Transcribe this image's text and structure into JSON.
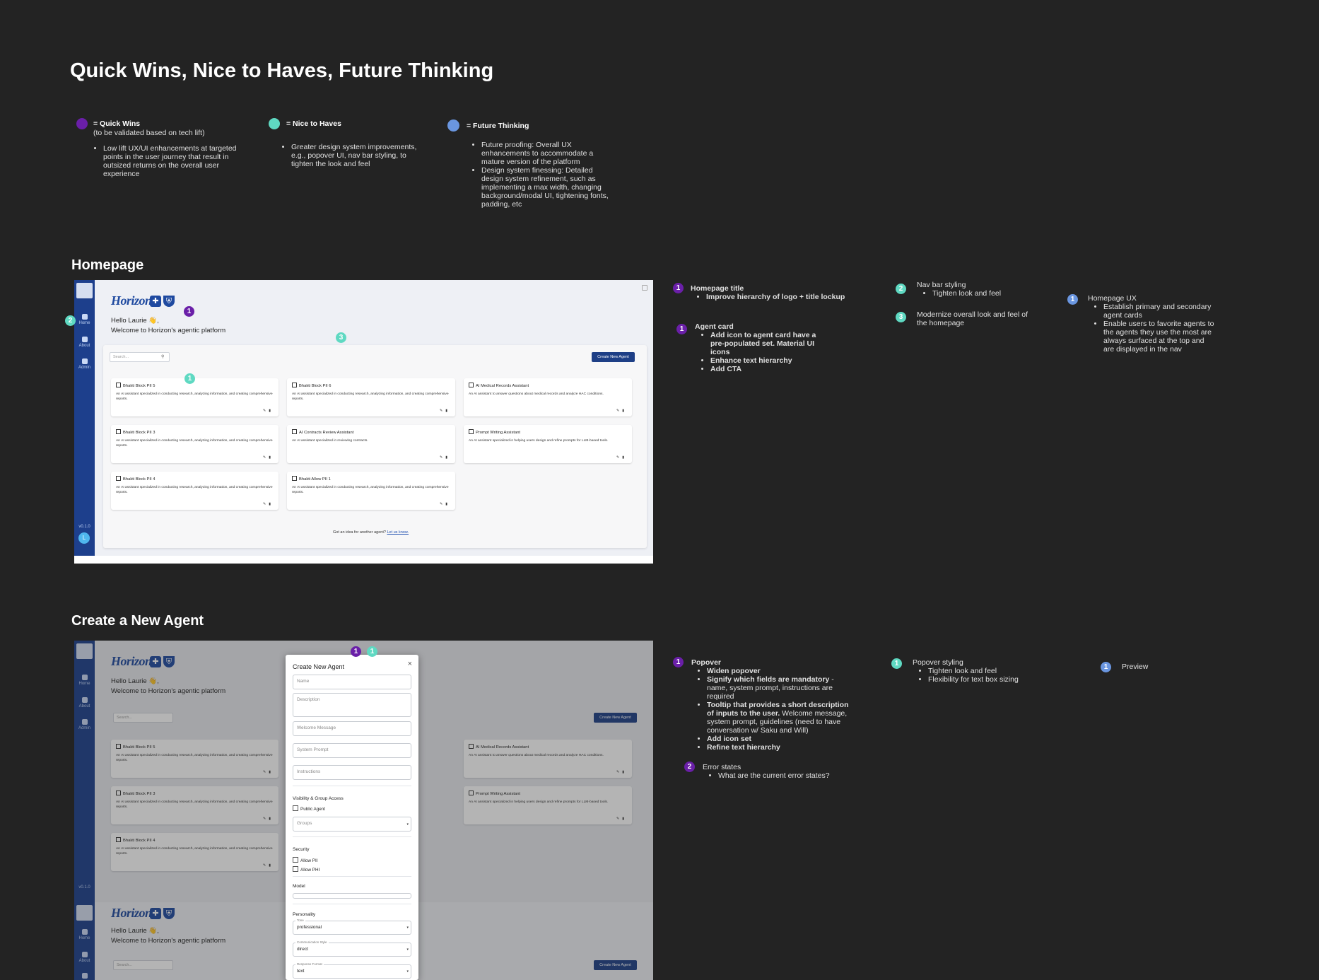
{
  "page_title": "Quick Wins, Nice to Haves, Future Thinking",
  "legend": {
    "quick_wins": {
      "title": "= Quick Wins",
      "subtitle": "(to be validated based on tech lift)",
      "bullets": [
        "Low lift UX/UI enhancements at targeted points in the user journey that result in outsized returns on the overall user experience"
      ]
    },
    "nice_to_haves": {
      "title": "= Nice to Haves",
      "bullets": [
        "Greater design system improvements, e.g., popover UI, nav bar styling, to tighten the look and feel"
      ]
    },
    "future_thinking": {
      "title": "= Future Thinking",
      "bullets": [
        "Future proofing: Overall UX enhancements to accommodate a mature version of the platform",
        "Design system finessing: Detailed design system refinement, such as implementing a max width, changing background/modal UI, tightening fonts, padding, etc"
      ]
    }
  },
  "colors": {
    "quick_wins": "#6a1fa8",
    "nice_to_haves": "#5fd9c2",
    "future_thinking": "#6a96e0"
  },
  "homepage": {
    "section_title": "Homepage",
    "markers": {
      "m1": "1",
      "m2": "2",
      "m3": "3",
      "m4": "1"
    },
    "ui": {
      "nav": {
        "home": "Home",
        "about": "About",
        "admin": "Admin",
        "version": "v0.1.0",
        "avatar": "L"
      },
      "logo_text": "Horizon.",
      "greeting": "Hello Laurie 👋,",
      "welcome": "Welcome to Horizon's agentic platform",
      "search_placeholder": "Search...",
      "create_button": "Create New Agent",
      "cards": [
        {
          "title": "Bhakti Block PII 5",
          "desc": "An AI assistant specialized in conducting research, analyzing information, and creating comprehensive reports."
        },
        {
          "title": "Bhakti Block PII 6",
          "desc": "An AI assistant specialized in conducting research, analyzing information, and creating comprehensive reports."
        },
        {
          "title": "AI Medical Records Assistant",
          "desc": "An AI assistant to answer questions about medical records and analyze HAC conditions."
        },
        {
          "title": "Bhakti Block PII 3",
          "desc": "An AI assistant specialized in conducting research, analyzing information, and creating comprehensive reports."
        },
        {
          "title": "AI Contracts Review Assistant",
          "desc": "An AI assistant specialized in reviewing contracts."
        },
        {
          "title": "Prompt Writing Assistant",
          "desc": "An AI assistant specialized in helping users design and refine prompts for LLM-based tools."
        },
        {
          "title": "Bhakti Block PII 4",
          "desc": "An AI assistant specialized in conducting research, analyzing information, and creating comprehensive reports."
        },
        {
          "title": "Bhakti Allow PII 1",
          "desc": "An AI assistant specialized in conducting research, analyzing information, and creating comprehensive reports."
        }
      ],
      "footer_text": "Got an idea for another agent?",
      "footer_link": "Let us know."
    },
    "notes": {
      "title_note": {
        "num": "1",
        "title": "Homepage title",
        "bullets": [
          "Improve hierarchy of logo + title lockup"
        ]
      },
      "card_note": {
        "num": "1",
        "title": "Agent card",
        "bullets": [
          "Add icon to agent card have a pre-populated set. Material UI icons",
          "Enhance text hierarchy",
          "Add CTA"
        ]
      },
      "nav_note": {
        "num": "2",
        "title": "Nav bar styling",
        "bullets": [
          "Tighten look and feel"
        ]
      },
      "modern_note": {
        "num": "3",
        "text": "Modernize overall look and feel of the homepage"
      },
      "ux_note": {
        "num": "1",
        "title": "Homepage UX",
        "bullets": [
          "Establish primary and secondary agent cards",
          "Enable users to favorite agents to the agents they use the most are always surfaced at the top and are displayed in the nav"
        ]
      }
    }
  },
  "create_agent": {
    "section_title": "Create a New Agent",
    "markers": {
      "m1": "1",
      "m2": "1"
    },
    "modal": {
      "title": "Create New Agent",
      "close": "×",
      "fields": {
        "name": "Name",
        "description": "Description",
        "welcome": "Welcome Message",
        "system_prompt": "System Prompt",
        "instructions": "Instructions"
      },
      "visibility_label": "Visibility & Group Access",
      "public_agent": "Public Agent",
      "groups": "Groups",
      "security_label": "Security",
      "allow_pii": "Allow PII",
      "allow_phi": "Allow PHI",
      "model_label": "Model",
      "personality_label": "Personality",
      "tone_label": "Tone",
      "tone_value": "professional",
      "comm_label": "Communication Style",
      "comm_value": "direct",
      "format_label": "Response Format",
      "format_value": "text"
    },
    "notes": {
      "popover": {
        "num": "1",
        "title": "Popover",
        "items": [
          {
            "bold": "Widen popover",
            "rest": ""
          },
          {
            "bold": "Signify which fields are mandatory",
            "rest": " - name, system prompt, instructions are required"
          },
          {
            "bold": "Tooltip that provides a short description of inputs to the user.",
            "rest": " Welcome message, system prompt, guidelines (need to have conversation w/ Saku and Will)"
          },
          {
            "bold": "Add icon set",
            "rest": ""
          },
          {
            "bold": "Refine text hierarchy",
            "rest": ""
          }
        ]
      },
      "errors": {
        "num": "2",
        "title": "Error states",
        "bullets": [
          "What are the current error states?"
        ]
      },
      "popover_styling": {
        "num": "1",
        "title": "Popover styling",
        "bullets": [
          "Tighten look and feel",
          "Flexibility for text box sizing"
        ]
      },
      "preview": {
        "num": "1",
        "title": "Preview"
      }
    }
  }
}
